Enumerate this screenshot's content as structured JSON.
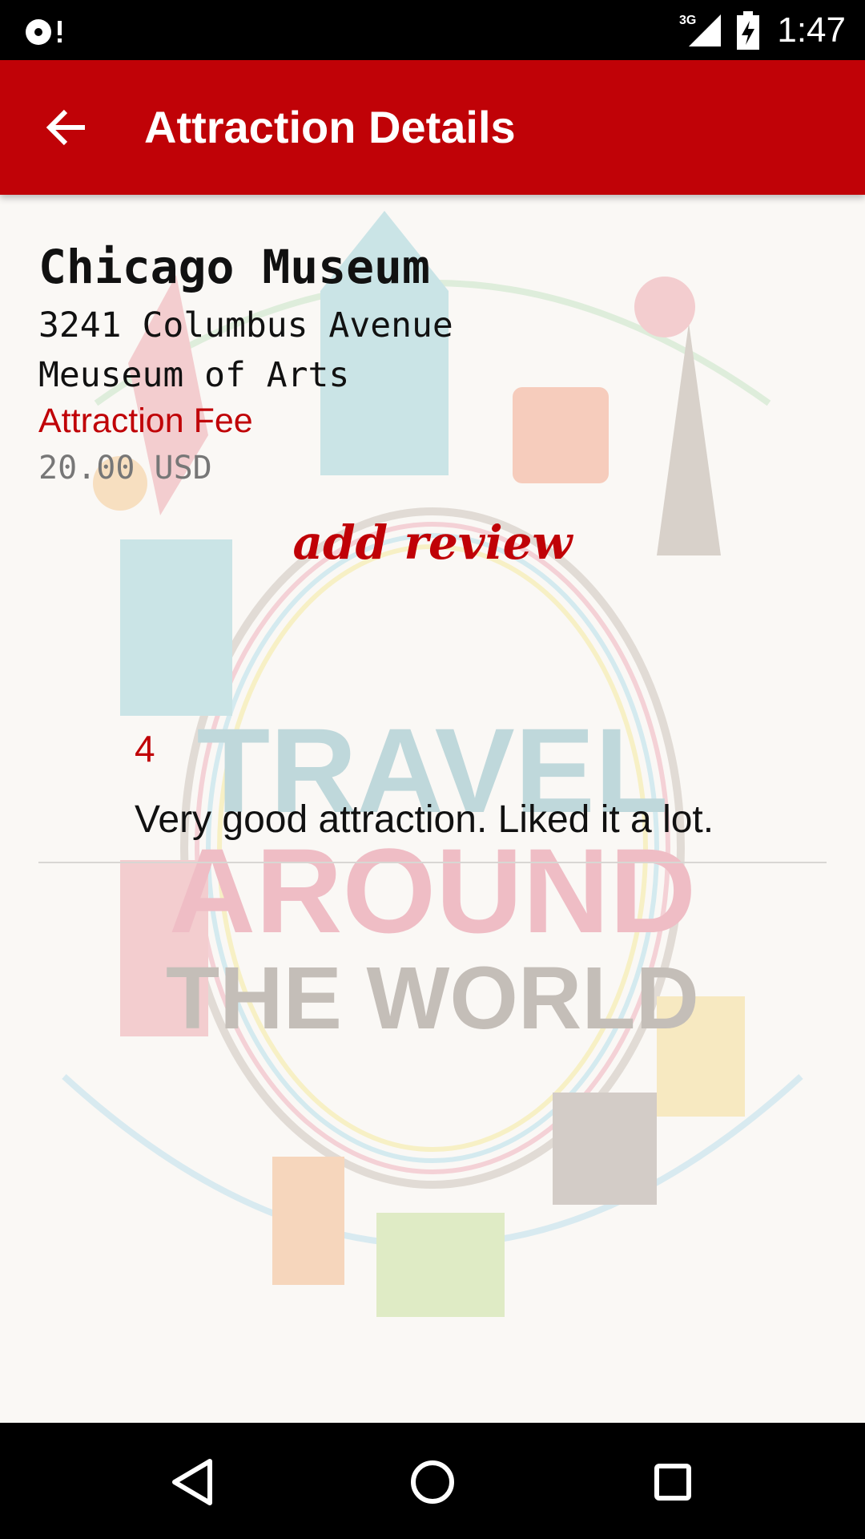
{
  "status_bar": {
    "time": "1:47",
    "network": "3G",
    "icons": [
      "notification-icon",
      "signal-icon",
      "battery-charging-icon"
    ]
  },
  "app_bar": {
    "title": "Attraction Details",
    "back_icon": "arrow-back-icon",
    "color": "#c00207"
  },
  "attraction": {
    "name": "Chicago Museum",
    "address": "3241 Columbus Avenue",
    "category": "Meuseum of Arts",
    "fee_label": "Attraction Fee",
    "fee_value": "20.00 USD"
  },
  "add_review_label": "add review",
  "reviews": [
    {
      "rating": "4",
      "text": "Very good attraction. Liked it a lot."
    }
  ],
  "background_art": {
    "lines": [
      "TRAVEL",
      "AROUND",
      "THE WORLD"
    ]
  },
  "nav_bar": {
    "icons": [
      "back-triangle-icon",
      "home-circle-icon",
      "recents-square-icon"
    ]
  }
}
